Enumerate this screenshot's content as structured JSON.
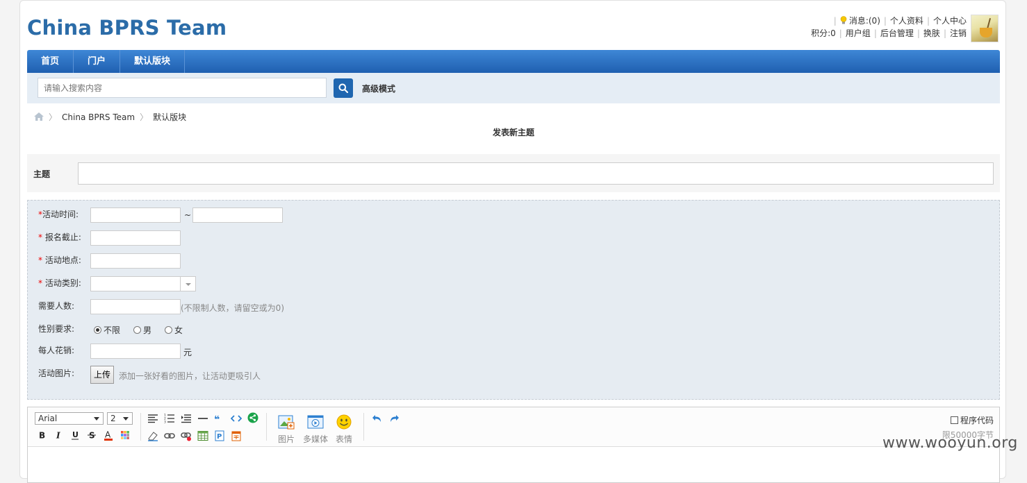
{
  "site": {
    "title": "China BPRS Team"
  },
  "usernav": {
    "messages": "消息:(0)",
    "profile": "个人资料",
    "center": "个人中心",
    "points": "积分:0",
    "usergroup": "用户组",
    "admin": "后台管理",
    "skin": "换肤",
    "logout": "注销"
  },
  "nav": {
    "items": [
      "首页",
      "门户",
      "默认版块"
    ]
  },
  "search": {
    "placeholder": "请输入搜索内容",
    "advanced": "高级模式"
  },
  "breadcrumb": {
    "items": [
      "China BPRS Team",
      "默认版块"
    ]
  },
  "post": {
    "title": "发表新主题",
    "subject_label": "主题"
  },
  "activity": {
    "time_label": "活动时间:",
    "time_sep": "~",
    "deadline_label": "报名截止:",
    "place_label": "活动地点:",
    "category_label": "活动类别:",
    "people_label": "需要人数:",
    "people_hint": "(不限制人数，请留空或为0)",
    "gender_label": "性别要求:",
    "gender_options": [
      "不限",
      "男",
      "女"
    ],
    "gender_selected": "不限",
    "cost_label": "每人花销:",
    "cost_unit": "元",
    "image_label": "活动图片:",
    "upload_label": "上传",
    "image_hint": "添加一张好看的图片，让活动更吸引人",
    "required_mark": "*"
  },
  "editor": {
    "font": "Arial",
    "size": "2",
    "image_label": "图片",
    "media_label": "多媒体",
    "emoji_label": "表情",
    "code_label": "程序代码",
    "limit_text": "限50000字节"
  },
  "watermark": "www.wooyun.org",
  "colors": {
    "brand": "#2b6ca8",
    "nav": "#1f5fb0",
    "required": "#e00000"
  }
}
